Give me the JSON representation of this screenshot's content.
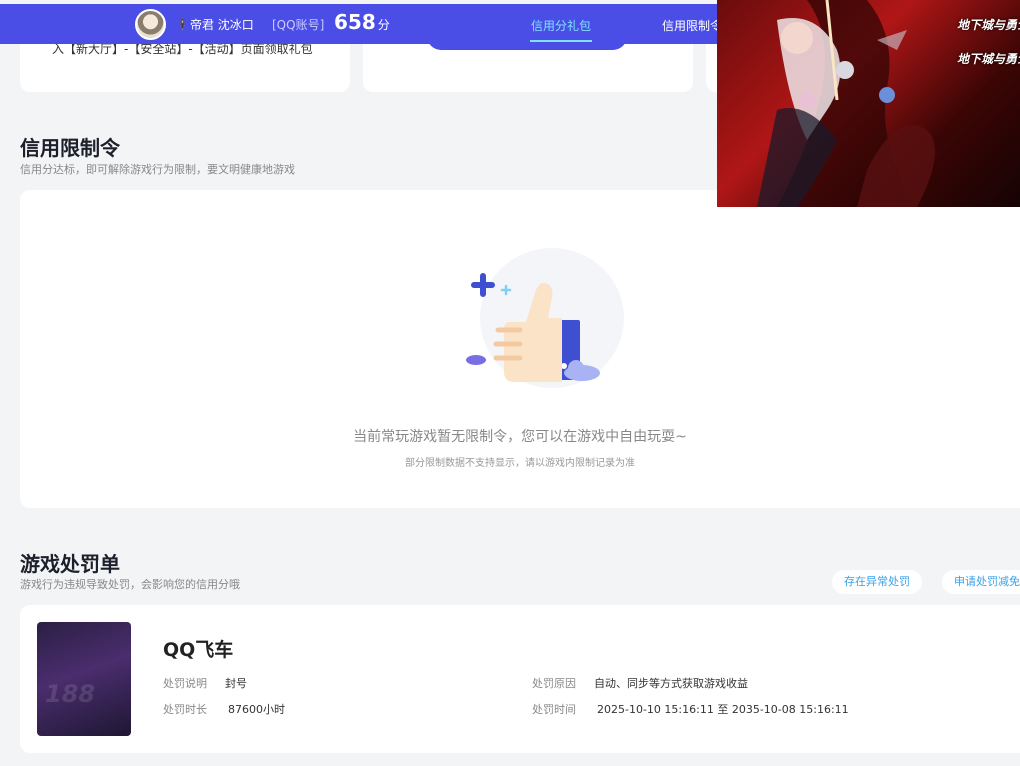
{
  "header": {
    "nickname": "🕴帝君 沈冰口",
    "account_label": "[QQ账号]",
    "score": "658",
    "score_unit": "分",
    "tabs": [
      {
        "label": "信用分礼包",
        "active": true
      },
      {
        "label": "信用限制令",
        "active": false
      }
    ]
  },
  "top_cards": {
    "first_text": "入【新大厅】-【安全站】-【活动】页面领取礼包"
  },
  "restriction": {
    "title": "信用限制令",
    "desc": "信用分达标，即可解除游戏行为限制，要文明健康地游戏",
    "empty_main": "当前常玩游戏暂无限制令，您可以在游戏中自由玩耍~",
    "empty_sub": "部分限制数据不支持显示，请以游戏内限制记录为准"
  },
  "penalty": {
    "title": "游戏处罚单",
    "desc": "游戏行为违规导致处罚，会影响您的信用分哦",
    "btn_abnormal": "存在异常处罚",
    "btn_reduce": "申请处罚减免",
    "item": {
      "game_name": "QQ飞车",
      "cover_mark": "188",
      "label_desc": "处罚说明",
      "value_desc": "封号",
      "label_duration": "处罚时长",
      "value_duration": "87600小时",
      "label_reason": "处罚原因",
      "value_reason": "自动、同步等方式获取游戏收益",
      "label_time": "处罚时间",
      "value_time": "2025-10-10 15:16:11 至 2035-10-08 15:16:11"
    }
  },
  "overlay_ad": {
    "logo_text": "地下城与勇士"
  },
  "colors": {
    "header_bg": "#4b4ee6",
    "active_tab": "#7fe3ff",
    "link_blue": "#3aa0e8"
  }
}
